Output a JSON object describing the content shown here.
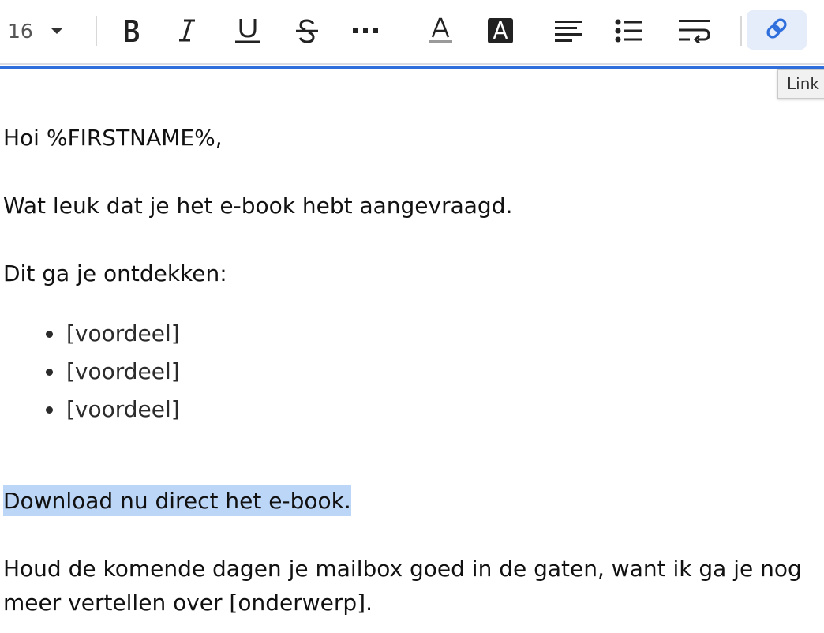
{
  "toolbar": {
    "font_size": "16",
    "buttons": [
      {
        "name": "bold",
        "icon": "bold-icon"
      },
      {
        "name": "italic",
        "icon": "italic-icon"
      },
      {
        "name": "underline",
        "icon": "underline-icon"
      },
      {
        "name": "strikethrough",
        "icon": "strikethrough-icon"
      },
      {
        "name": "more",
        "icon": "more-horizontal-icon"
      },
      {
        "name": "text-color",
        "icon": "text-color-icon"
      },
      {
        "name": "highlight-color",
        "icon": "text-background-icon"
      },
      {
        "name": "align",
        "icon": "align-left-icon"
      },
      {
        "name": "bullet-list",
        "icon": "bullet-list-icon"
      },
      {
        "name": "text-wrap",
        "icon": "text-wrap-icon"
      },
      {
        "name": "link",
        "icon": "link-icon",
        "active": true
      }
    ],
    "accent_color": "#2f6fdc",
    "active_bg": "#e5edfb"
  },
  "tooltip": {
    "text": "Link"
  },
  "editor": {
    "greeting": "Hoi %FIRSTNAME%,",
    "intro": "Wat leuk dat je het e-book hebt aangevraagd.",
    "discover": "Dit ga je ontdekken:",
    "benefits": [
      "[voordeel]",
      "[voordeel]",
      "[voordeel]"
    ],
    "download": "Download nu direct het e-book.",
    "followup_line1": "Houd de komende dagen je mailbox goed in de gaten, want ik ga je nog",
    "followup_line2": "meer vertellen over [onderwerp].",
    "selection_color": "#bcd6f7"
  }
}
